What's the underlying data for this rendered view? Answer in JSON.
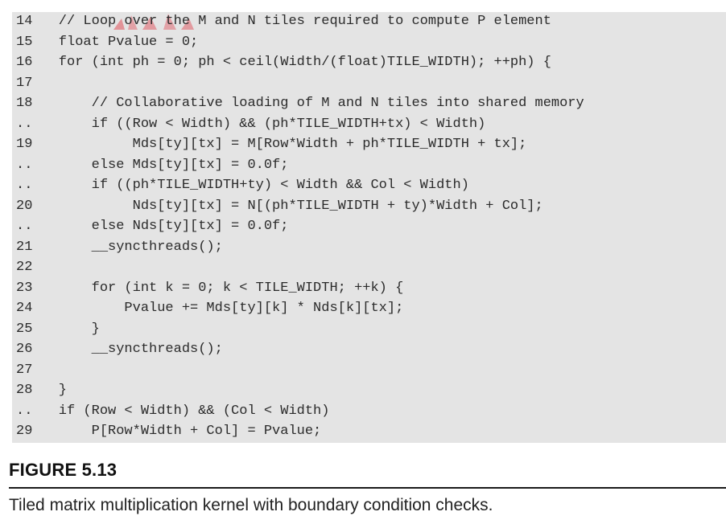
{
  "code_lines": [
    {
      "num": "14",
      "text": "    // Loop over the M and N tiles required to compute P element"
    },
    {
      "num": "15",
      "text": "    float Pvalue = 0;"
    },
    {
      "num": "16",
      "text": "    for (int ph = 0; ph < ceil(Width/(float)TILE_WIDTH); ++ph) {"
    },
    {
      "num": "17",
      "text": ""
    },
    {
      "num": "18",
      "text": "        // Collaborative loading of M and N tiles into shared memory"
    },
    {
      "num": "..",
      "text": "        if ((Row < Width) && (ph*TILE_WIDTH+tx) < Width)"
    },
    {
      "num": "19",
      "text": "             Mds[ty][tx] = M[Row*Width + ph*TILE_WIDTH + tx];"
    },
    {
      "num": "..",
      "text": "        else Mds[ty][tx] = 0.0f;"
    },
    {
      "num": "..",
      "text": "        if ((ph*TILE_WIDTH+ty) < Width && Col < Width)"
    },
    {
      "num": "20",
      "text": "             Nds[ty][tx] = N[(ph*TILE_WIDTH + ty)*Width + Col];"
    },
    {
      "num": "..",
      "text": "        else Nds[ty][tx] = 0.0f;"
    },
    {
      "num": "21",
      "text": "        __syncthreads();"
    },
    {
      "num": "22",
      "text": ""
    },
    {
      "num": "23",
      "text": "        for (int k = 0; k < TILE_WIDTH; ++k) {"
    },
    {
      "num": "24",
      "text": "            Pvalue += Mds[ty][k] * Nds[k][tx];"
    },
    {
      "num": "25",
      "text": "        }"
    },
    {
      "num": "26",
      "text": "        __syncthreads();"
    },
    {
      "num": "27",
      "text": ""
    },
    {
      "num": "28",
      "text": "    }"
    },
    {
      "num": "..",
      "text": "    if (Row < Width) && (Col < Width)"
    },
    {
      "num": "29",
      "text": "        P[Row*Width + Col] = Pvalue;"
    }
  ],
  "figure": {
    "title": "FIGURE 5.13",
    "caption": "Tiled matrix multiplication kernel with boundary condition checks."
  },
  "colors": {
    "code_background": "#e4e4e4",
    "code_text": "#2b2b2b",
    "rule": "#1a1a1a",
    "watermark": "#e0505a"
  }
}
